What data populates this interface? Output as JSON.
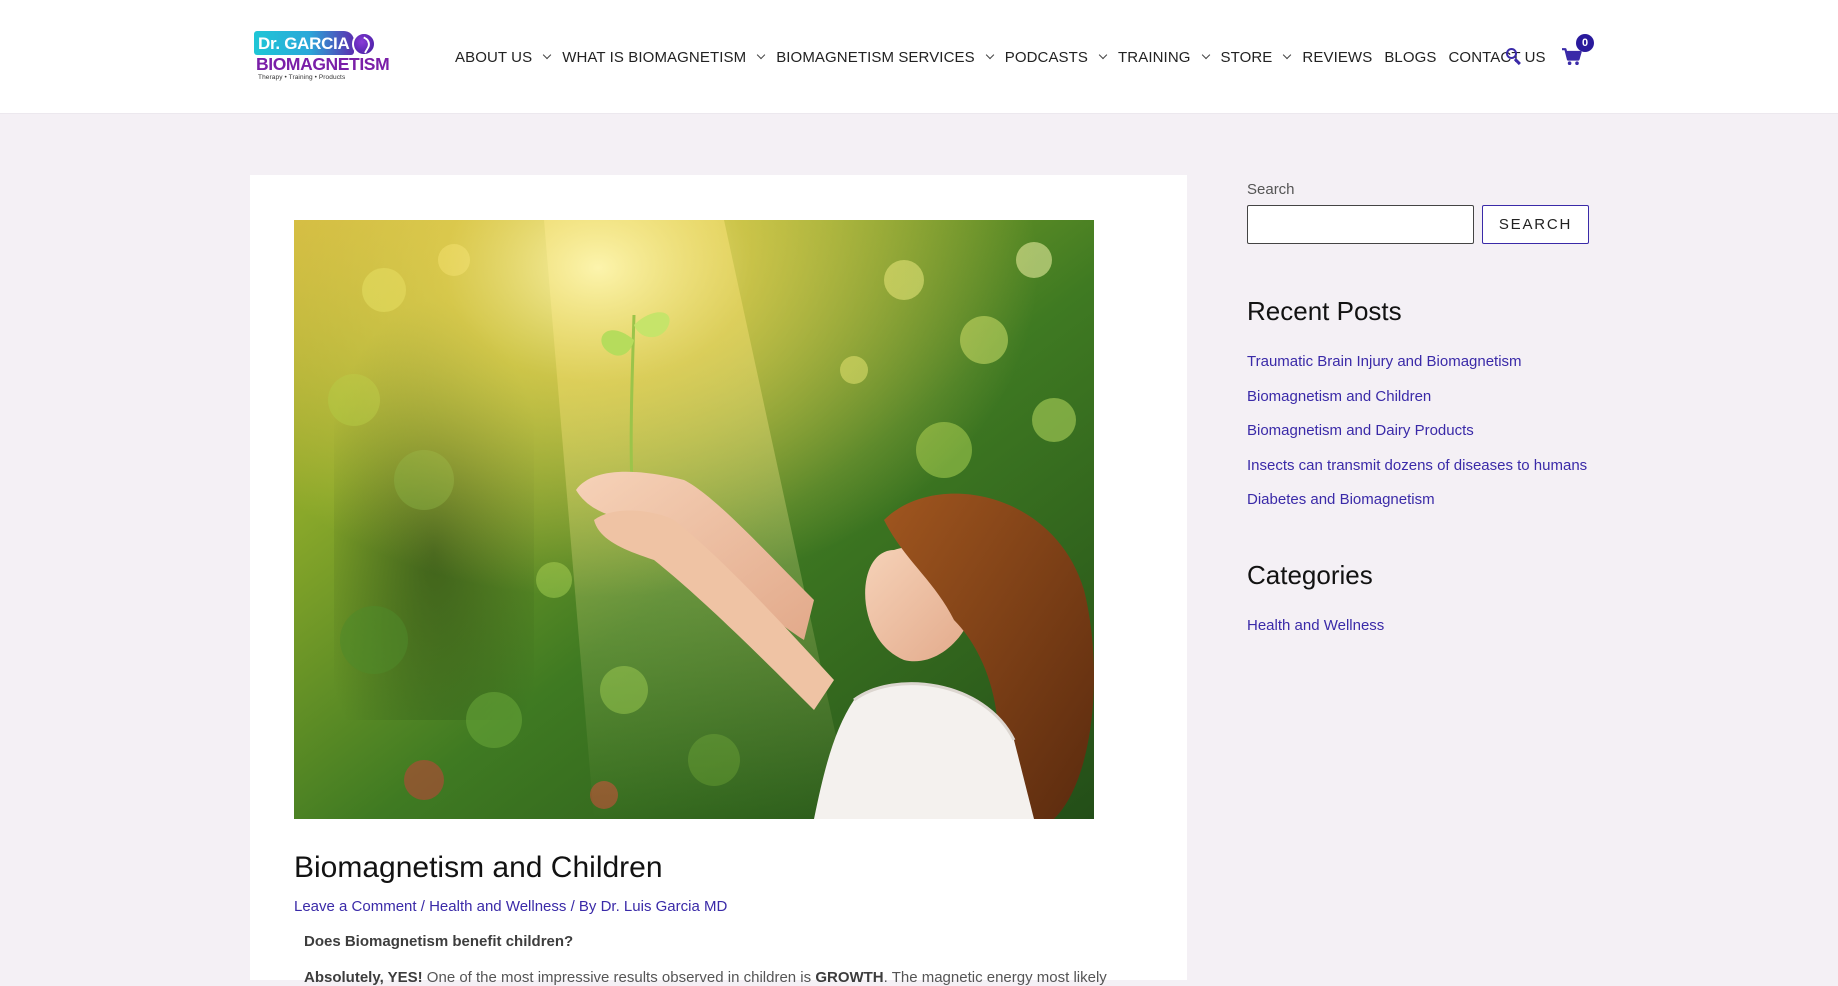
{
  "header": {
    "logo": {
      "top_text": "Dr. GARCIA",
      "main_text": "BIOMAGNETISM",
      "tagline": "Therapy • Training • Products"
    },
    "nav": [
      {
        "label": "ABOUT US",
        "has_dropdown": true
      },
      {
        "label": "WHAT IS BIOMAGNETISM",
        "has_dropdown": true
      },
      {
        "label": "BIOMAGNETISM SERVICES",
        "has_dropdown": true
      },
      {
        "label": "PODCASTS",
        "has_dropdown": true
      },
      {
        "label": "TRAINING",
        "has_dropdown": true
      },
      {
        "label": "STORE",
        "has_dropdown": true
      },
      {
        "label": "REVIEWS",
        "has_dropdown": false
      },
      {
        "label": "BLOGS",
        "has_dropdown": false
      },
      {
        "label": "CONTACT US",
        "has_dropdown": false
      }
    ],
    "cart_count": "0",
    "icons": {
      "search": "search-icon",
      "cart": "cart-icon"
    }
  },
  "article": {
    "image": "child-holding-seedling-photo",
    "title": "Biomagnetism and Children",
    "meta": {
      "comment_link": "Leave a Comment",
      "separator": "/",
      "category": "Health and Wellness",
      "by_prefix": "/ By",
      "author": "Dr. Luis Garcia MD"
    },
    "question": "Does Biomagnetism benefit children?",
    "body": {
      "lead_bold": "Absolutely, YES!",
      "text_1": " One of the most impressive results observed in children is ",
      "bold_2": "GROWTH",
      "text_2": ". The magnetic energy most likely"
    }
  },
  "sidebar": {
    "search": {
      "label": "Search",
      "value": "",
      "button": "SEARCH"
    },
    "recent_posts": {
      "title": "Recent Posts",
      "items": [
        "Traumatic Brain Injury and Biomagnetism",
        "Biomagnetism and Children",
        "Biomagnetism and Dairy Products",
        "Insects can transmit dozens of diseases to humans",
        "Diabetes and Biomagnetism"
      ]
    },
    "categories": {
      "title": "Categories",
      "items": [
        "Health and Wellness"
      ]
    }
  },
  "colors": {
    "accent": "#3a2aa8",
    "page_bg": "#f4f0f5",
    "logo_purple": "#7a1fa8",
    "logo_cyan": "#1fc6d6"
  }
}
